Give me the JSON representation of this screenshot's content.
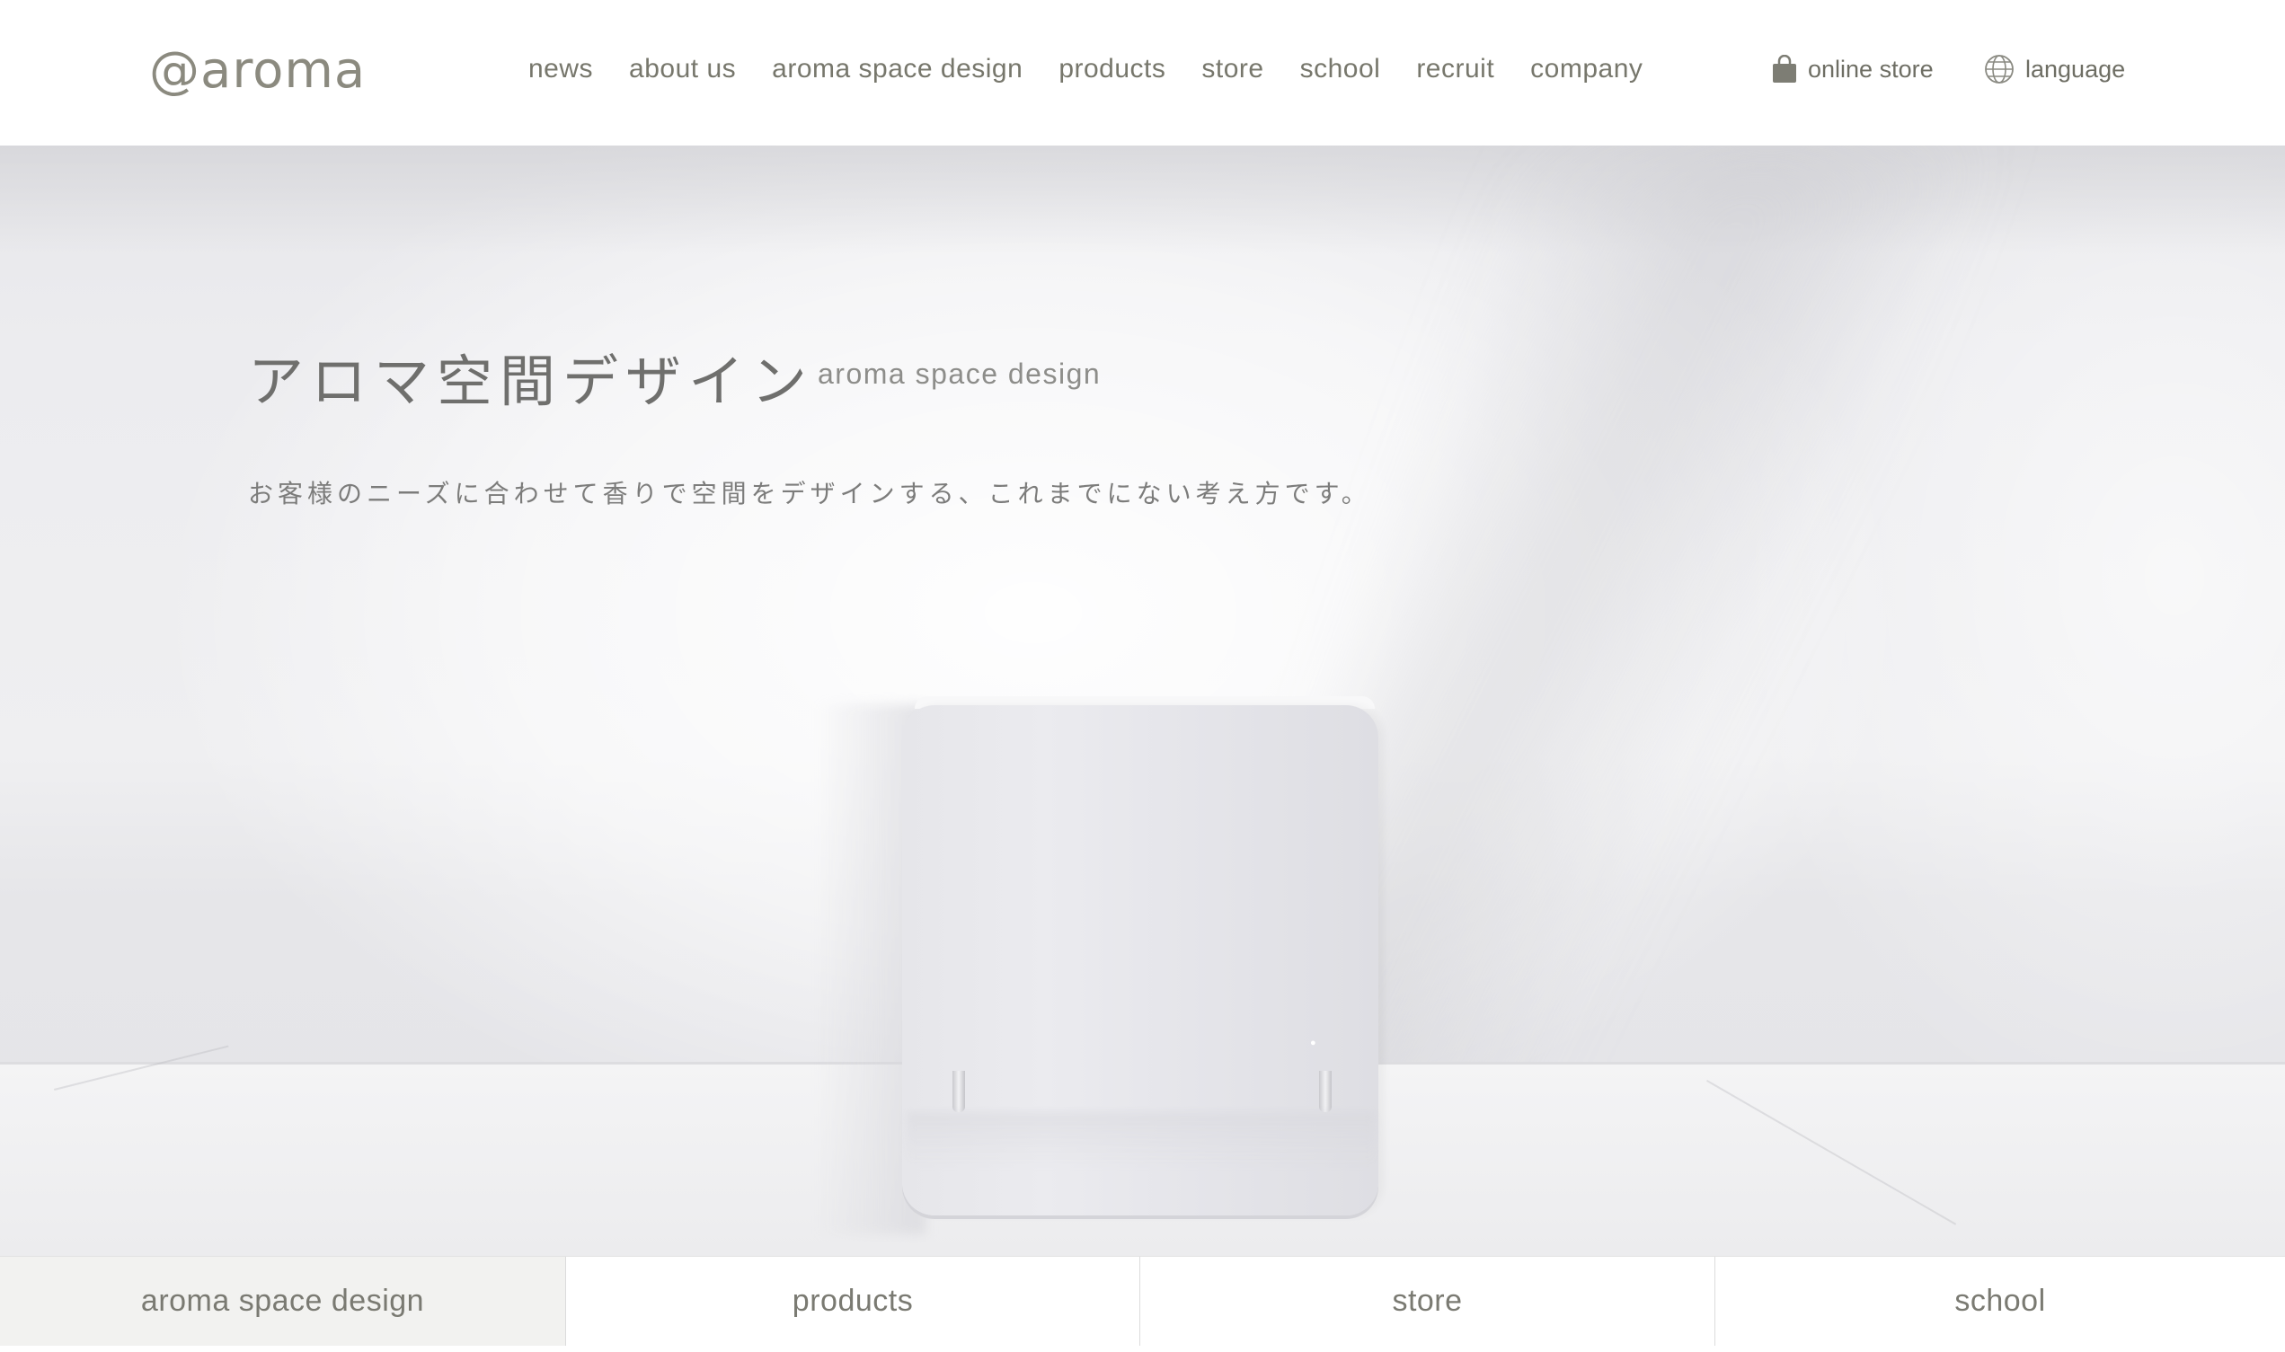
{
  "header": {
    "logo_text": "@aroma",
    "nav": [
      {
        "label": "news"
      },
      {
        "label": "about us"
      },
      {
        "label": "aroma space design"
      },
      {
        "label": "products"
      },
      {
        "label": "store"
      },
      {
        "label": "school"
      },
      {
        "label": "recruit"
      },
      {
        "label": "company"
      }
    ],
    "online_store_label": "online store",
    "online_store_icon": "shopping-bag-icon",
    "language_label": "language",
    "language_icon": "globe-icon"
  },
  "hero": {
    "title": "アロマ空間デザイン",
    "subtitle": "aroma space design",
    "description": "お客様のニーズに合わせて香りで空間をデザインする、これまでにない考え方です。"
  },
  "tabs": [
    {
      "label": "aroma space design",
      "active": true
    },
    {
      "label": "products",
      "active": false
    },
    {
      "label": "store",
      "active": false
    },
    {
      "label": "school",
      "active": false
    }
  ],
  "colors": {
    "text": "#77776c",
    "logo": "#8b8a7f",
    "active_tab_bg": "#f2f2f0"
  }
}
